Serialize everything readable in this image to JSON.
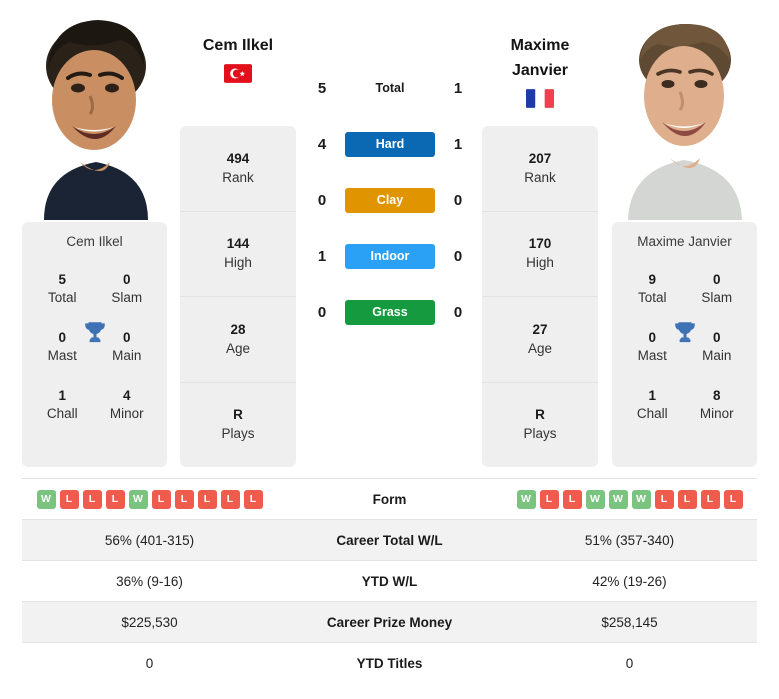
{
  "players": {
    "left": {
      "name": "Cem Ilkel",
      "flag": "turkey-flag",
      "card_name": "Cem Ilkel",
      "rank": "494",
      "rank_label": "Rank",
      "high": "144",
      "high_label": "High",
      "age": "28",
      "age_label": "Age",
      "plays": "R",
      "plays_label": "Plays",
      "titles": {
        "total": "5",
        "total_label": "Total",
        "slam": "0",
        "slam_label": "Slam",
        "mast": "0",
        "mast_label": "Mast",
        "main": "0",
        "main_label": "Main",
        "chall": "1",
        "chall_label": "Chall",
        "minor": "4",
        "minor_label": "Minor"
      },
      "form": [
        "W",
        "L",
        "L",
        "L",
        "W",
        "L",
        "L",
        "L",
        "L",
        "L"
      ],
      "career_wl": "56% (401-315)",
      "ytd_wl": "36% (9-16)",
      "career_prize": "$225,530",
      "ytd_titles": "0"
    },
    "right": {
      "name_line1": "Maxime",
      "name_line2": "Janvier",
      "flag": "france-flag",
      "card_name": "Maxime Janvier",
      "rank": "207",
      "rank_label": "Rank",
      "high": "170",
      "high_label": "High",
      "age": "27",
      "age_label": "Age",
      "plays": "R",
      "plays_label": "Plays",
      "titles": {
        "total": "9",
        "total_label": "Total",
        "slam": "0",
        "slam_label": "Slam",
        "mast": "0",
        "mast_label": "Mast",
        "main": "0",
        "main_label": "Main",
        "chall": "1",
        "chall_label": "Chall",
        "minor": "8",
        "minor_label": "Minor"
      },
      "form": [
        "W",
        "L",
        "L",
        "W",
        "W",
        "W",
        "L",
        "L",
        "L",
        "L"
      ],
      "career_wl": "51% (357-340)",
      "ytd_wl": "42% (19-26)",
      "career_prize": "$258,145",
      "ytd_titles": "0"
    }
  },
  "surfaces": [
    {
      "label": "Total",
      "left": "5",
      "right": "1",
      "color": "transparent",
      "plain": true
    },
    {
      "label": "Hard",
      "left": "4",
      "right": "1",
      "color": "#0b69b4",
      "plain": false
    },
    {
      "label": "Clay",
      "left": "0",
      "right": "0",
      "color": "#e09400",
      "plain": false
    },
    {
      "label": "Indoor",
      "left": "1",
      "right": "0",
      "color": "#2ba1f5",
      "plain": false
    },
    {
      "label": "Grass",
      "left": "0",
      "right": "0",
      "color": "#159a40",
      "plain": false
    }
  ],
  "table_rows": [
    {
      "label": "Form",
      "type": "form",
      "left": "",
      "right": ""
    },
    {
      "label": "Career Total W/L",
      "type": "text",
      "left": "56% (401-315)",
      "right": "51% (357-340)"
    },
    {
      "label": "YTD W/L",
      "type": "text",
      "left": "36% (9-16)",
      "right": "42% (19-26)"
    },
    {
      "label": "Career Prize Money",
      "type": "text",
      "left": "$225,530",
      "right": "$258,145"
    },
    {
      "label": "YTD Titles",
      "type": "text",
      "left": "0",
      "right": "0"
    }
  ],
  "colors": {
    "hard": "#0b69b4",
    "clay": "#e09400",
    "indoor": "#2ba1f5",
    "grass": "#159a40",
    "win_badge": "#7ac47f",
    "loss_badge": "#ef5b4c",
    "trophy": "#3e72b5",
    "card_bg": "#efefef"
  }
}
